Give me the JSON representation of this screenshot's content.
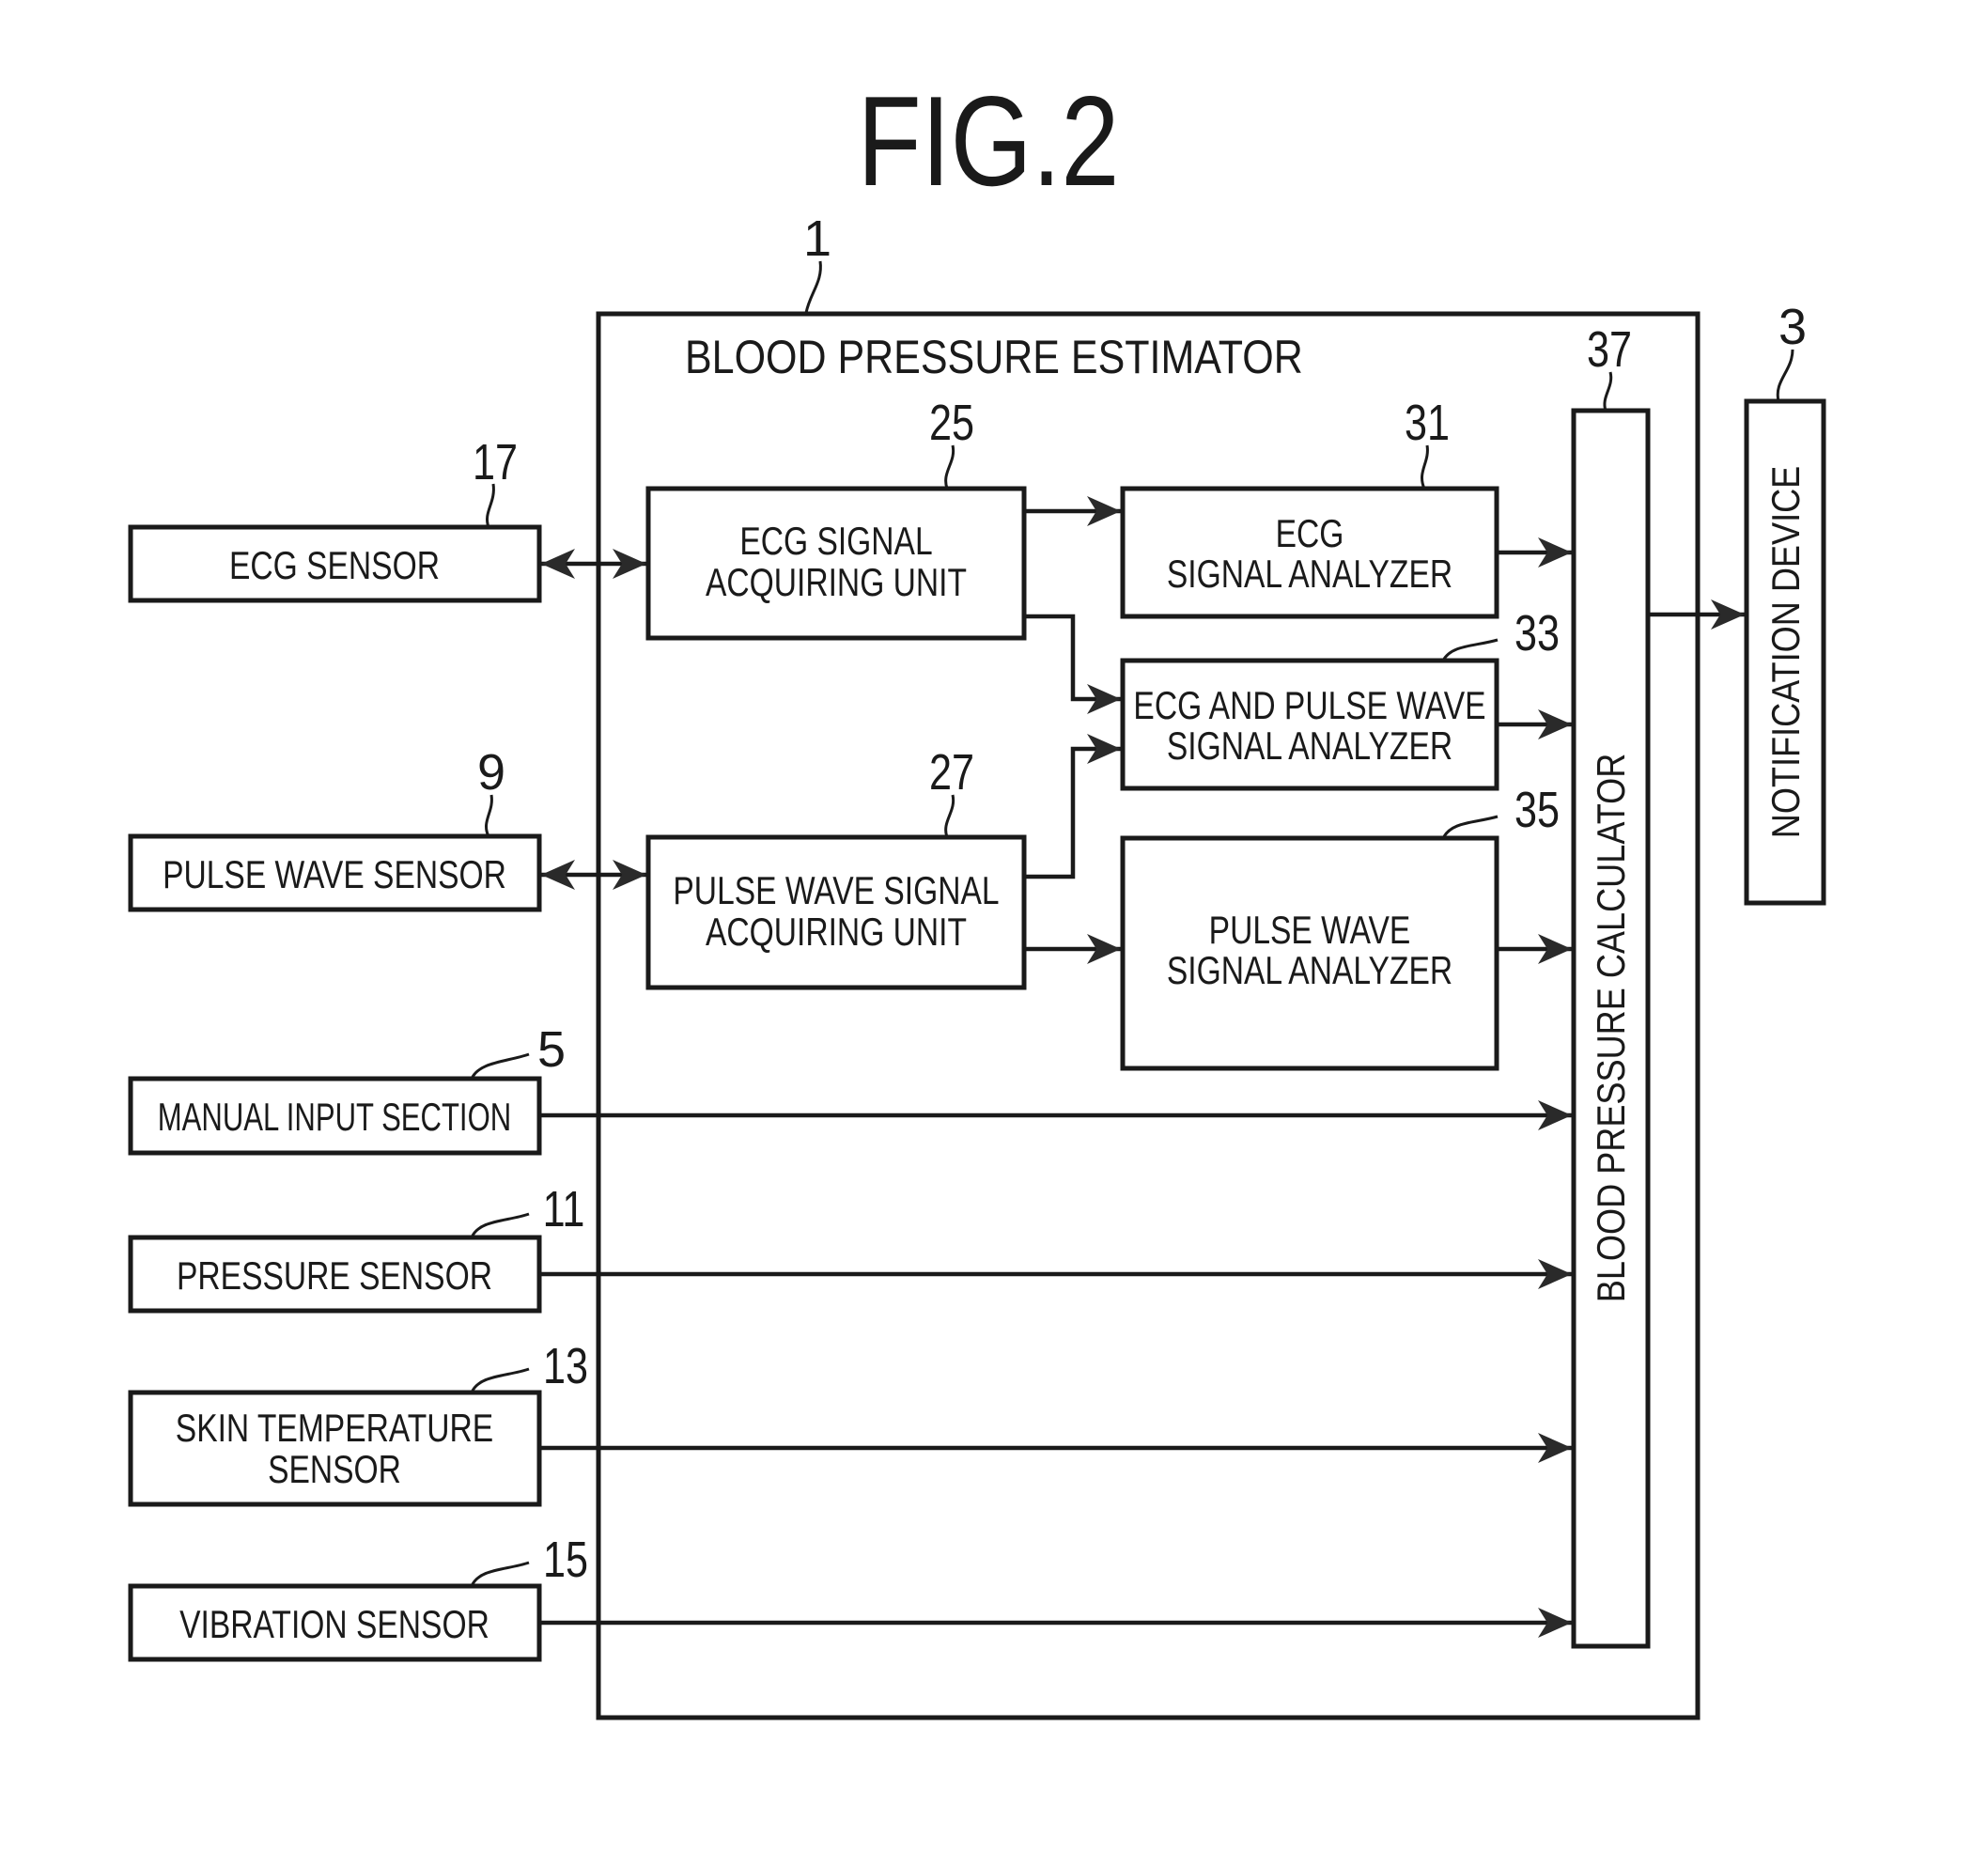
{
  "figure": {
    "title": "FIG.2",
    "system_label": "BLOOD PRESSURE ESTIMATOR",
    "system_ref": "1"
  },
  "external_inputs": [
    {
      "ref": "17",
      "lines": [
        "ECG SENSOR"
      ]
    },
    {
      "ref": "9",
      "lines": [
        "PULSE WAVE SENSOR"
      ]
    },
    {
      "ref": "5",
      "lines": [
        "MANUAL INPUT SECTION"
      ]
    },
    {
      "ref": "11",
      "lines": [
        "PRESSURE SENSOR"
      ]
    },
    {
      "ref": "13",
      "lines": [
        "SKIN TEMPERATURE",
        "SENSOR"
      ]
    },
    {
      "ref": "15",
      "lines": [
        "VIBRATION SENSOR"
      ]
    }
  ],
  "acquiring_units": [
    {
      "ref": "25",
      "lines": [
        "ECG SIGNAL",
        "ACQUIRING UNIT"
      ]
    },
    {
      "ref": "27",
      "lines": [
        "PULSE WAVE SIGNAL",
        "ACQUIRING UNIT"
      ]
    }
  ],
  "analyzers": [
    {
      "ref": "31",
      "lines": [
        "ECG",
        "SIGNAL ANALYZER"
      ]
    },
    {
      "ref": "33",
      "lines": [
        "ECG AND PULSE WAVE",
        "SIGNAL ANALYZER"
      ]
    },
    {
      "ref": "35",
      "lines": [
        "PULSE WAVE",
        "SIGNAL ANALYZER"
      ]
    }
  ],
  "calculator": {
    "ref": "37",
    "label": "BLOOD PRESSURE CALCULATOR"
  },
  "output_device": {
    "ref": "3",
    "label": "NOTIFICATION DEVICE"
  },
  "connections": [
    {
      "from": "ECG SENSOR",
      "to": "ECG SIGNAL ACQUIRING UNIT",
      "type": "bidirectional"
    },
    {
      "from": "PULSE WAVE SENSOR",
      "to": "PULSE WAVE SIGNAL ACQUIRING UNIT",
      "type": "bidirectional"
    },
    {
      "from": "ECG SIGNAL ACQUIRING UNIT",
      "to": "ECG SIGNAL ANALYZER",
      "type": "arrow"
    },
    {
      "from": "ECG SIGNAL ACQUIRING UNIT",
      "to": "ECG AND PULSE WAVE SIGNAL ANALYZER",
      "type": "arrow"
    },
    {
      "from": "PULSE WAVE SIGNAL ACQUIRING UNIT",
      "to": "ECG AND PULSE WAVE SIGNAL ANALYZER",
      "type": "arrow"
    },
    {
      "from": "PULSE WAVE SIGNAL ACQUIRING UNIT",
      "to": "PULSE WAVE SIGNAL ANALYZER",
      "type": "arrow"
    },
    {
      "from": "ECG SIGNAL ANALYZER",
      "to": "BLOOD PRESSURE CALCULATOR",
      "type": "arrow"
    },
    {
      "from": "ECG AND PULSE WAVE SIGNAL ANALYZER",
      "to": "BLOOD PRESSURE CALCULATOR",
      "type": "arrow"
    },
    {
      "from": "PULSE WAVE SIGNAL ANALYZER",
      "to": "BLOOD PRESSURE CALCULATOR",
      "type": "arrow"
    },
    {
      "from": "MANUAL INPUT SECTION",
      "to": "BLOOD PRESSURE CALCULATOR",
      "type": "arrow"
    },
    {
      "from": "PRESSURE SENSOR",
      "to": "BLOOD PRESSURE CALCULATOR",
      "type": "arrow"
    },
    {
      "from": "SKIN TEMPERATURE SENSOR",
      "to": "BLOOD PRESSURE CALCULATOR",
      "type": "arrow"
    },
    {
      "from": "VIBRATION SENSOR",
      "to": "BLOOD PRESSURE CALCULATOR",
      "type": "arrow"
    },
    {
      "from": "BLOOD PRESSURE CALCULATOR",
      "to": "NOTIFICATION DEVICE",
      "type": "arrow"
    }
  ]
}
